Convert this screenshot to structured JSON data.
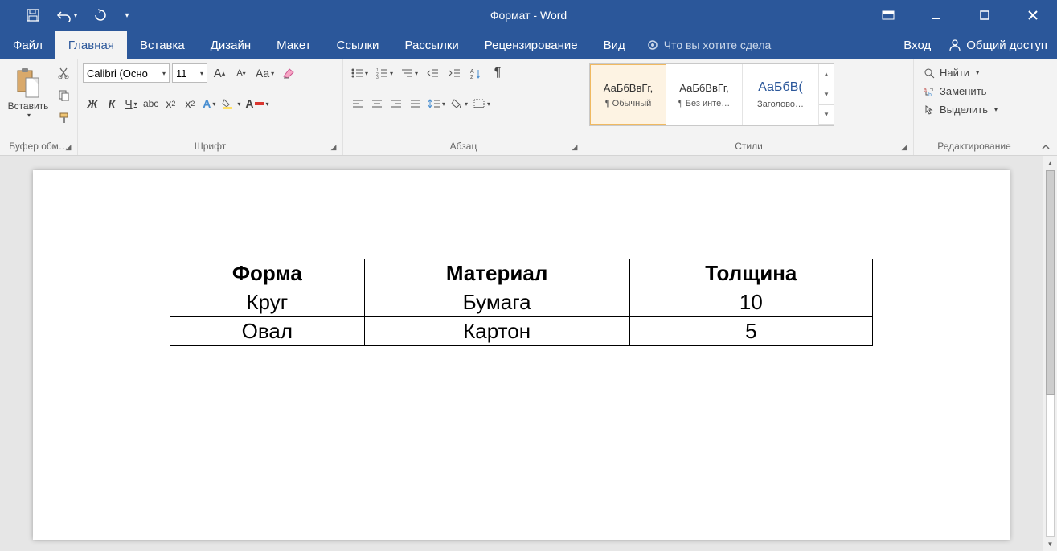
{
  "titlebar": {
    "title": "Формат - Word"
  },
  "tabs": {
    "file": "Файл",
    "items": [
      "Главная",
      "Вставка",
      "Дизайн",
      "Макет",
      "Ссылки",
      "Рассылки",
      "Рецензирование",
      "Вид"
    ],
    "active": 0,
    "tellme": "Что вы хотите сдела",
    "signin": "Вход",
    "share": "Общий доступ"
  },
  "ribbon": {
    "clipboard": {
      "paste": "Вставить",
      "label": "Буфер обм…"
    },
    "font": {
      "name": "Calibri (Осно",
      "size": "11",
      "label": "Шрифт",
      "bold": "Ж",
      "italic": "К",
      "underline": "Ч",
      "strike": "abc",
      "case": "Aa"
    },
    "paragraph": {
      "label": "Абзац"
    },
    "styles": {
      "label": "Стили",
      "items": [
        {
          "preview": "АаБбВвГг,",
          "name": "¶ Обычный"
        },
        {
          "preview": "АаБбВвГг,",
          "name": "¶ Без инте…"
        },
        {
          "preview": "АаБбВ(",
          "name": "Заголово…"
        }
      ]
    },
    "editing": {
      "label": "Редактирование",
      "find": "Найти",
      "replace": "Заменить",
      "select": "Выделить"
    }
  },
  "document": {
    "table": {
      "headers": [
        "Форма",
        "Материал",
        "Толщина"
      ],
      "rows": [
        [
          "Круг",
          "Бумага",
          "10"
        ],
        [
          "Овал",
          "Картон",
          "5"
        ]
      ]
    }
  }
}
